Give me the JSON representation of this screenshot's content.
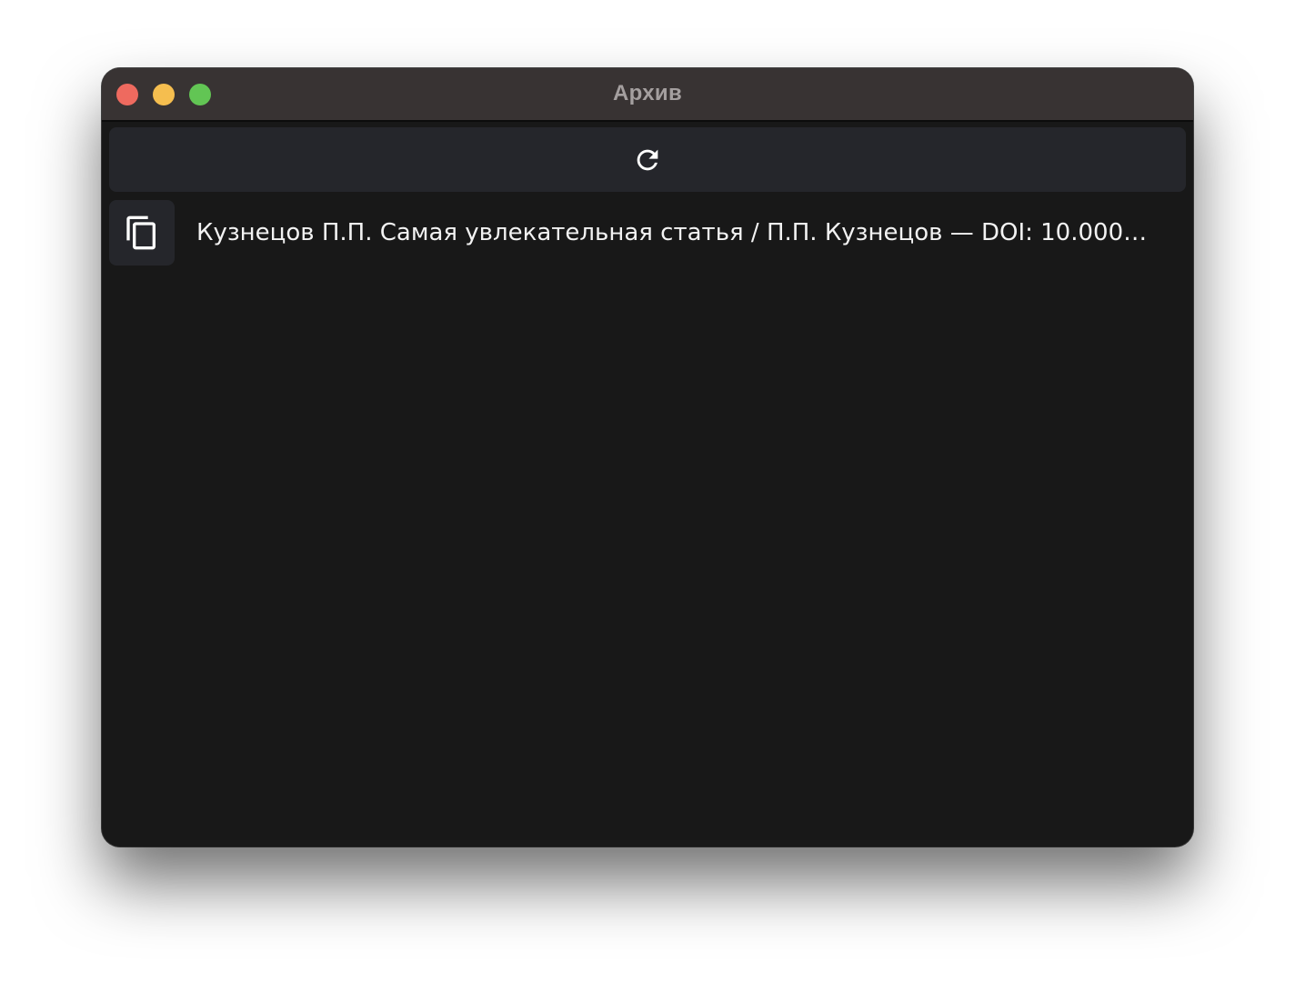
{
  "window": {
    "title": "Архив"
  },
  "toolbar": {
    "refresh_icon": "refresh-icon"
  },
  "list": {
    "items": [
      {
        "text": "Кузнецов П.П. Самая увлекательная статья / П.П. Кузнецов — DOI: 10.0000...",
        "action_icon": "copy-icon"
      }
    ]
  },
  "colors": {
    "window_background": "#181818",
    "titlebar": "#383333",
    "panel": "#25262b",
    "text": "#f2f2f2",
    "title_text": "#a49f9f",
    "close": "#ee6a5f",
    "minimize": "#f5be4f",
    "maximize": "#62c554"
  }
}
